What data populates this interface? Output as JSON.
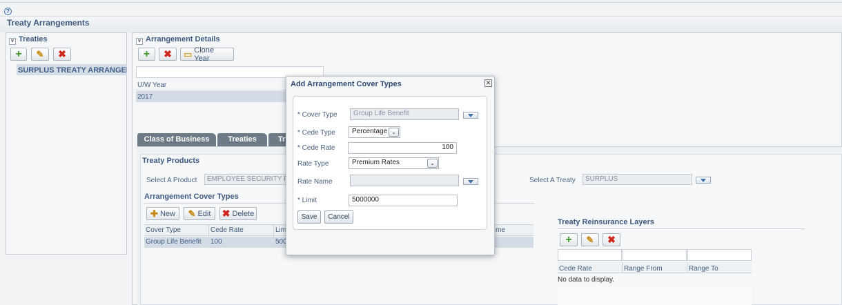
{
  "page": {
    "help_icon": "?",
    "title": "Treaty Arrangements"
  },
  "treaties": {
    "header": "Treaties",
    "icons": [
      "add-icon",
      "edit-icon",
      "delete-icon"
    ],
    "selected_item": "SURPLUS TREATY ARRANGEMENT"
  },
  "arrangement": {
    "header": "Arrangement Details",
    "clone_label": "Clone Year",
    "uw_year_header": "U/W Year",
    "uw_year_value": "2017"
  },
  "tabs": {
    "class_of_business": "Class of Business",
    "treaties": "Treaties",
    "third": "Tr"
  },
  "treaty_products": {
    "header": "Treaty Products",
    "select_product_label": "Select A Product",
    "select_product_value": "EMPLOYEE SECURITY PLAN",
    "select_treaty_label": "Select A Treaty",
    "select_treaty_value": "SURPLUS"
  },
  "cover_types": {
    "header": "Arrangement Cover Types",
    "new_label": "New",
    "edit_label": "Edit",
    "delete_label": "Delete",
    "columns": [
      "Cover Type",
      "Cede Rate",
      "Limit",
      "Name"
    ],
    "columns_visible": [
      "Cover Type",
      "Cede Rate",
      "Lim",
      "me"
    ],
    "row": [
      "Group Life Benefit",
      "100",
      "500"
    ]
  },
  "layers": {
    "header": "Treaty Reinsurance Layers",
    "columns": [
      "Cede Rate",
      "Range From",
      "Range To"
    ],
    "empty_text": "No data to display."
  },
  "modal": {
    "title": "Add Arrangement Cover Types",
    "close_icon": "close-icon",
    "cover_type_label": "* Cover Type",
    "cover_type_value": "Group Life Benefit",
    "cede_type_label": "* Cede Type",
    "cede_type_value": "Percentage",
    "cede_rate_label": "* Cede Rate",
    "cede_rate_value": "100",
    "rate_type_label": "Rate Type",
    "rate_type_value": "Premium Rates",
    "rate_name_label": "Rate Name",
    "rate_name_value": "",
    "limit_label": "* Limit",
    "limit_value": "5000000",
    "save_label": "Save",
    "cancel_label": "Cancel"
  }
}
